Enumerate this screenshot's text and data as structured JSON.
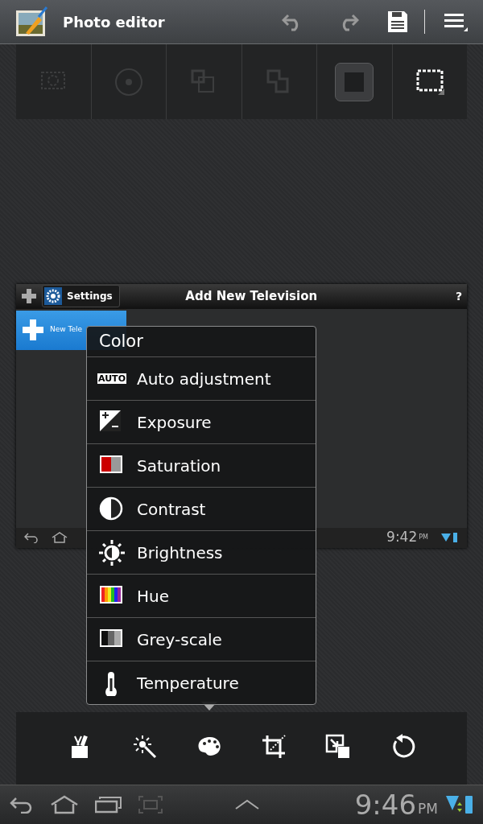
{
  "action_bar": {
    "title": "Photo editor"
  },
  "selection_tools": [
    {
      "kind": "lasso",
      "selected": false,
      "disabled": true
    },
    {
      "kind": "brush",
      "selected": false,
      "disabled": true
    },
    {
      "kind": "add",
      "selected": false,
      "disabled": true
    },
    {
      "kind": "subtract",
      "selected": false,
      "disabled": true
    },
    {
      "kind": "square",
      "selected": true,
      "disabled": false
    },
    {
      "kind": "marquee",
      "selected": false,
      "disabled": false
    }
  ],
  "embedded_screenshot": {
    "settings_label": "Settings",
    "title": "Add New Television",
    "help": "?",
    "list_item": "New Tele",
    "time": "9:42",
    "ampm": "PM"
  },
  "color_menu": {
    "title": "Color",
    "items": [
      {
        "kind": "auto",
        "icon_text": "AUTO",
        "label": "Auto adjustment"
      },
      {
        "kind": "exposure",
        "label": "Exposure"
      },
      {
        "kind": "saturation",
        "label": "Saturation"
      },
      {
        "kind": "contrast",
        "label": "Contrast"
      },
      {
        "kind": "brightness",
        "label": "Brightness"
      },
      {
        "kind": "hue",
        "label": "Hue"
      },
      {
        "kind": "greyscale",
        "label": "Grey-scale"
      },
      {
        "kind": "temperature",
        "label": "Temperature"
      }
    ]
  },
  "toolbar": [
    {
      "kind": "tools",
      "selected": false
    },
    {
      "kind": "effects",
      "selected": false
    },
    {
      "kind": "color",
      "selected": true
    },
    {
      "kind": "crop",
      "selected": false
    },
    {
      "kind": "resize",
      "selected": false
    },
    {
      "kind": "rotate",
      "selected": false
    }
  ],
  "status_bar": {
    "time": "9:46",
    "ampm": "PM"
  }
}
